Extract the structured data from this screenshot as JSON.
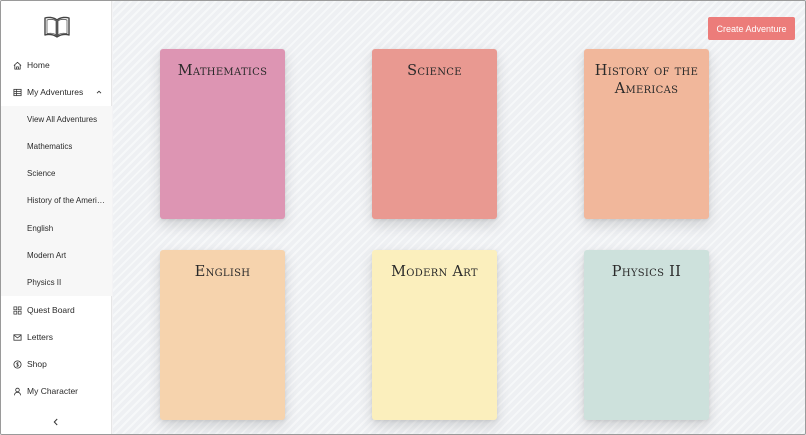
{
  "sidebar": {
    "logo_icon": "open-book-icon",
    "nav": {
      "home": {
        "label": "Home",
        "icon": "home-icon"
      },
      "my_adventures": {
        "label": "My Adventures",
        "icon": "table-icon"
      },
      "quest_board": {
        "label": "Quest Board",
        "icon": "grid-icon"
      },
      "letters": {
        "label": "Letters",
        "icon": "mail-icon"
      },
      "shop": {
        "label": "Shop",
        "icon": "coin-icon"
      },
      "my_character": {
        "label": "My Character",
        "icon": "user-icon"
      }
    },
    "adventures": [
      "View All Adventures",
      "Mathematics",
      "Science",
      "History of the Americas",
      "English",
      "Modern Art",
      "Physics II"
    ]
  },
  "header": {
    "create_label": "Create Adventure"
  },
  "books": [
    {
      "title": "Mathematics",
      "color": "#dd95b3"
    },
    {
      "title": "Science",
      "color": "#e99991"
    },
    {
      "title": "History of the Americas",
      "color": "#f1b79b"
    },
    {
      "title": "English",
      "color": "#f6d3ad"
    },
    {
      "title": "Modern Art",
      "color": "#fbefbd"
    },
    {
      "title": "Physics II",
      "color": "#cde1dc"
    }
  ],
  "colors": {
    "accent": "#ec7c7a"
  }
}
